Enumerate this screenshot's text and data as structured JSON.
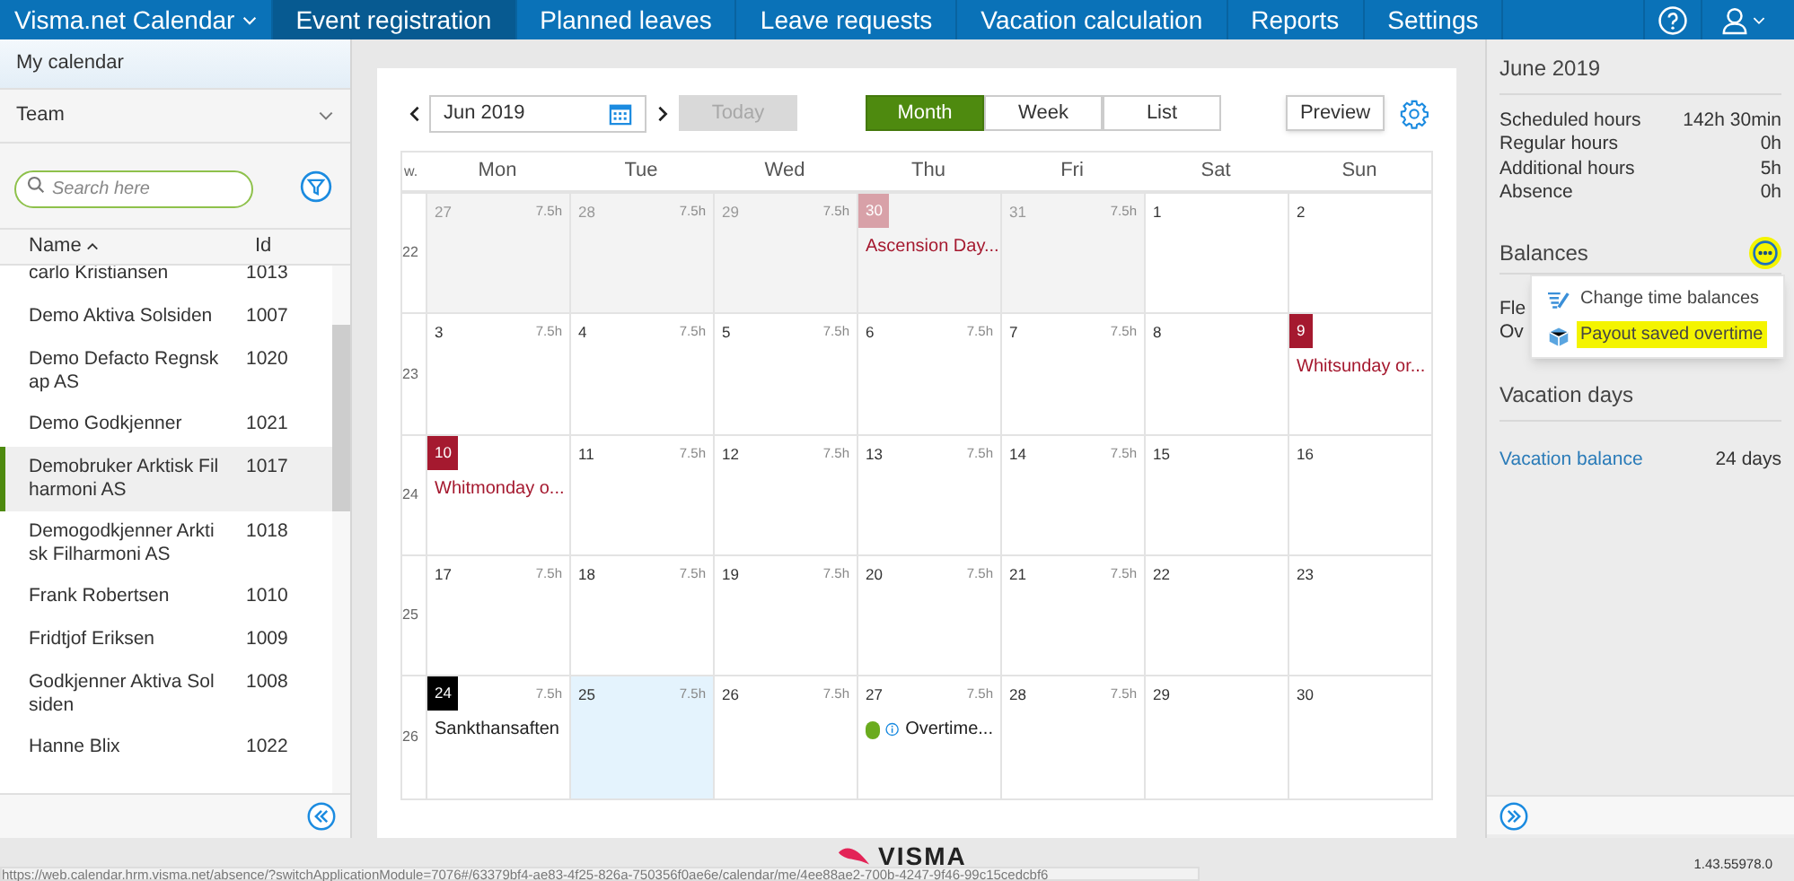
{
  "nav": {
    "app": "Visma.net Calendar",
    "tabs": [
      {
        "label": "Event registration",
        "selected": true
      },
      {
        "label": "Planned leaves",
        "selected": false
      },
      {
        "label": "Leave requests",
        "selected": false
      },
      {
        "label": "Vacation calculation",
        "selected": false
      },
      {
        "label": "Reports",
        "selected": false
      },
      {
        "label": "Settings",
        "selected": false
      }
    ]
  },
  "sidebar": {
    "my_calendar": "My calendar",
    "team": "Team",
    "search": {
      "placeholder": "Search here"
    },
    "columns": [
      "Name",
      "Id"
    ],
    "rows": [
      {
        "name": "carlo Kristiansen",
        "id": "1013",
        "selected": false
      },
      {
        "name": "Demo Aktiva Solsiden",
        "id": "1007",
        "selected": false
      },
      {
        "name": "Demo Defacto Regnskap AS",
        "id": "1020",
        "selected": false
      },
      {
        "name": "Demo Godkjenner",
        "id": "1021",
        "selected": false
      },
      {
        "name": "Demobruker Arktisk Filharmoni AS",
        "id": "1017",
        "selected": true
      },
      {
        "name": "Demogodkjenner Arktisk Filharmoni AS",
        "id": "1018",
        "selected": false
      },
      {
        "name": "Frank Robertsen",
        "id": "1010",
        "selected": false
      },
      {
        "name": "Fridtjof Eriksen",
        "id": "1009",
        "selected": false
      },
      {
        "name": "Godkjenner Aktiva Solsiden",
        "id": "1008",
        "selected": false
      },
      {
        "name": "Hanne Blix",
        "id": "1022",
        "selected": false
      }
    ]
  },
  "toolbar": {
    "period": "Jun 2019",
    "today": "Today",
    "today_disabled": true,
    "views": [
      {
        "label": "Month",
        "selected": true
      },
      {
        "label": "Week",
        "selected": false
      },
      {
        "label": "List",
        "selected": false
      }
    ],
    "preview": "Preview"
  },
  "calendar": {
    "week_label": "w.",
    "days": [
      "Mon",
      "Tue",
      "Wed",
      "Thu",
      "Fri",
      "Sat",
      "Sun"
    ],
    "weeks": [
      {
        "number": "22",
        "cells": [
          {
            "day": "27",
            "hours": "7.5h",
            "outside": true,
            "selected": false
          },
          {
            "day": "28",
            "hours": "7.5h",
            "outside": true,
            "selected": false
          },
          {
            "day": "29",
            "hours": "7.5h",
            "outside": true,
            "selected": false
          },
          {
            "day": "30",
            "outside": true,
            "selected": false,
            "color": "#d8a1a8",
            "event": {
              "kind": "holiday",
              "text": "Ascension Day..."
            }
          },
          {
            "day": "31",
            "hours": "7.5h",
            "outside": true,
            "selected": false
          },
          {
            "day": "1",
            "outside": false,
            "selected": false
          },
          {
            "day": "2",
            "outside": false,
            "selected": false
          }
        ]
      },
      {
        "number": "23",
        "cells": [
          {
            "day": "3",
            "hours": "7.5h",
            "outside": false,
            "selected": false
          },
          {
            "day": "4",
            "hours": "7.5h",
            "outside": false,
            "selected": false
          },
          {
            "day": "5",
            "hours": "7.5h",
            "outside": false,
            "selected": false
          },
          {
            "day": "6",
            "hours": "7.5h",
            "outside": false,
            "selected": false
          },
          {
            "day": "7",
            "hours": "7.5h",
            "outside": false,
            "selected": false
          },
          {
            "day": "8",
            "outside": false,
            "selected": false
          },
          {
            "day": "9",
            "outside": false,
            "selected": false,
            "color": "#a5192f",
            "event": {
              "kind": "holiday",
              "text": "Whitsunday or..."
            }
          }
        ]
      },
      {
        "number": "24",
        "cells": [
          {
            "day": "10",
            "outside": false,
            "selected": false,
            "color": "#a5192f",
            "event": {
              "kind": "holiday",
              "text": "Whitmonday o..."
            }
          },
          {
            "day": "11",
            "hours": "7.5h",
            "outside": false,
            "selected": false
          },
          {
            "day": "12",
            "hours": "7.5h",
            "outside": false,
            "selected": false
          },
          {
            "day": "13",
            "hours": "7.5h",
            "outside": false,
            "selected": false
          },
          {
            "day": "14",
            "hours": "7.5h",
            "outside": false,
            "selected": false
          },
          {
            "day": "15",
            "outside": false,
            "selected": false
          },
          {
            "day": "16",
            "outside": false,
            "selected": false
          }
        ]
      },
      {
        "number": "25",
        "cells": [
          {
            "day": "17",
            "hours": "7.5h",
            "outside": false,
            "selected": false
          },
          {
            "day": "18",
            "hours": "7.5h",
            "outside": false,
            "selected": false
          },
          {
            "day": "19",
            "hours": "7.5h",
            "outside": false,
            "selected": false
          },
          {
            "day": "20",
            "hours": "7.5h",
            "outside": false,
            "selected": false
          },
          {
            "day": "21",
            "hours": "7.5h",
            "outside": false,
            "selected": false
          },
          {
            "day": "22",
            "outside": false,
            "selected": false
          },
          {
            "day": "23",
            "outside": false,
            "selected": false
          }
        ]
      },
      {
        "number": "26",
        "cells": [
          {
            "day": "24",
            "hours": "7.5h",
            "outside": false,
            "selected": false,
            "color": "#000000",
            "event": {
              "kind": "plain",
              "text": "Sankthansaften"
            }
          },
          {
            "day": "25",
            "hours": "7.5h",
            "outside": false,
            "selected": true
          },
          {
            "day": "26",
            "hours": "7.5h",
            "outside": false,
            "selected": false
          },
          {
            "day": "27",
            "hours": "7.5h",
            "outside": false,
            "selected": false,
            "event": {
              "kind": "overtime",
              "color": "#6aab1e",
              "text": "Overtime..."
            }
          },
          {
            "day": "28",
            "hours": "7.5h",
            "outside": false,
            "selected": false
          },
          {
            "day": "29",
            "outside": false,
            "selected": false
          },
          {
            "day": "30",
            "outside": false,
            "selected": false
          }
        ]
      }
    ]
  },
  "summary": {
    "title": "June 2019",
    "hours": [
      {
        "label": "Scheduled hours",
        "value": "142h 30min"
      },
      {
        "label": "Regular hours",
        "value": "0h"
      },
      {
        "label": "Additional hours",
        "value": "5h"
      },
      {
        "label": "Absence",
        "value": "0h"
      }
    ],
    "balances_title": "Balances",
    "balances_partial": [
      "Fle",
      "Ov"
    ],
    "menu": [
      {
        "kind": "change",
        "label": "Change time balances",
        "highlighted": false
      },
      {
        "kind": "payout",
        "label": "Payout saved overtime",
        "highlighted": true
      }
    ],
    "vacation_title": "Vacation days",
    "vacation": {
      "label": "Vacation balance",
      "value": "24 days"
    }
  },
  "footer": {
    "logo": "VISMA",
    "version": "1.43.55978.0",
    "status_url": "https://web.calendar.hrm.visma.net/absence/?switchApplicationModule=7076#/63379bf4-ae83-4f25-826a-750356f0ae6e/calendar/me/4ee88ae2-700b-4247-9f46-99c15cedcbf6"
  }
}
